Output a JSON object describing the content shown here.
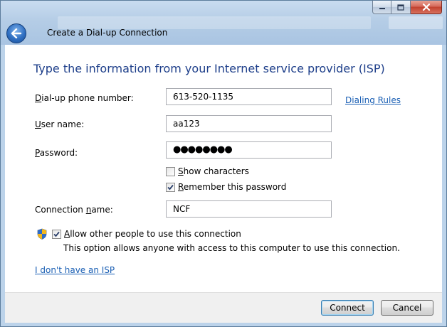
{
  "window": {
    "title": "Create a Dial-up Connection"
  },
  "icons": {
    "back": "back-arrow-icon",
    "minimize": "minimize-icon",
    "maximize": "maximize-icon",
    "close": "close-icon",
    "shield": "uac-shield-icon",
    "check": "checkmark-icon"
  },
  "form": {
    "heading": "Type the information from your Internet service provider (ISP)",
    "phone": {
      "label_key": "D",
      "label_rest": "ial-up phone number:",
      "value": "613-520-1135"
    },
    "dialing_rules_link": "Dialing Rules",
    "username": {
      "label_key": "U",
      "label_rest": "ser name:",
      "value": "aa123"
    },
    "password": {
      "label_key": "P",
      "label_rest": "assword:",
      "value": "●●●●●●●●"
    },
    "show_characters": {
      "label_key": "S",
      "label_rest": "how characters",
      "checked": false
    },
    "remember_password": {
      "label_key": "R",
      "label_rest": "emember this password",
      "checked": true
    },
    "connection_name": {
      "label_pre": "Connection ",
      "label_key": "n",
      "label_rest": "ame:",
      "value": "NCF"
    },
    "allow_others": {
      "label_key": "A",
      "label_rest": "llow other people to use this connection",
      "checked": true,
      "description": "This option allows anyone with access to this computer to use this connection."
    },
    "no_isp_link": {
      "label_key": "I",
      "label_rest": " don't have an ISP"
    }
  },
  "footer": {
    "connect_label": "Connect",
    "cancel_label": "Cancel"
  },
  "colors": {
    "heading": "#1e3f8a",
    "link": "#1a5fb4",
    "titlebar": "#b5cde6"
  }
}
